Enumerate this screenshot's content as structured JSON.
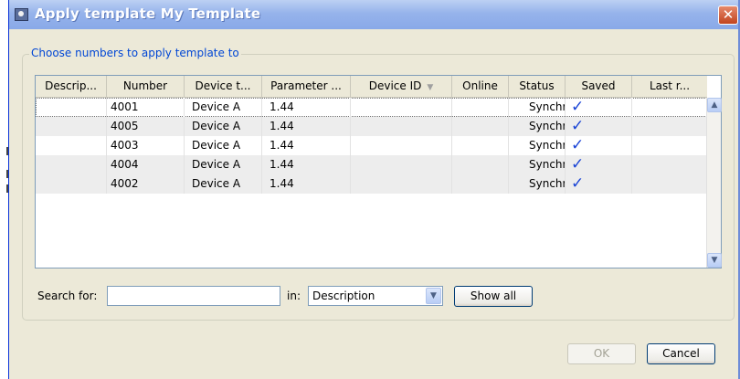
{
  "window": {
    "title": "Apply template My Template",
    "close_symbol": "✕"
  },
  "group": {
    "legend": "Choose numbers to apply template to"
  },
  "table": {
    "columns": [
      "Descrip...",
      "Number",
      "Device t...",
      "Parameter ...",
      "Device ID",
      "Online",
      "Status",
      "Saved",
      "Last r..."
    ],
    "sorted_column": "Device ID",
    "rows": [
      {
        "description": "",
        "number": "4001",
        "device_type": "Device A",
        "parameter": "1.44",
        "device_id": "",
        "online": "",
        "status": "Synchr...",
        "saved": "✓",
        "last_r": ""
      },
      {
        "description": "",
        "number": "4005",
        "device_type": "Device A",
        "parameter": "1.44",
        "device_id": "",
        "online": "",
        "status": "Synchr...",
        "saved": "✓",
        "last_r": ""
      },
      {
        "description": "",
        "number": "4003",
        "device_type": "Device A",
        "parameter": "1.44",
        "device_id": "",
        "online": "",
        "status": "Synchr...",
        "saved": "✓",
        "last_r": ""
      },
      {
        "description": "",
        "number": "4004",
        "device_type": "Device A",
        "parameter": "1.44",
        "device_id": "",
        "online": "",
        "status": "Synchr...",
        "saved": "✓",
        "last_r": ""
      },
      {
        "description": "",
        "number": "4002",
        "device_type": "Device A",
        "parameter": "1.44",
        "device_id": "",
        "online": "",
        "status": "Synchr...",
        "saved": "✓",
        "last_r": ""
      }
    ]
  },
  "search": {
    "label": "Search for:",
    "value": "",
    "in_label": "in:",
    "field_selected": "Description",
    "show_all_label": "Show all"
  },
  "buttons": {
    "ok_label": "OK",
    "cancel_label": "Cancel"
  },
  "icons": {
    "sort": "sort-down-icon",
    "scroll_up": "scroll-up-icon",
    "scroll_down": "scroll-down-icon",
    "dropdown": "chevron-down-icon",
    "saved": "checkmark-icon"
  },
  "colors": {
    "titlebar": "#96b3eb",
    "legend_text": "#0046d5",
    "checkmark": "#1a44d6",
    "dialog_bg": "#ece9d8"
  }
}
